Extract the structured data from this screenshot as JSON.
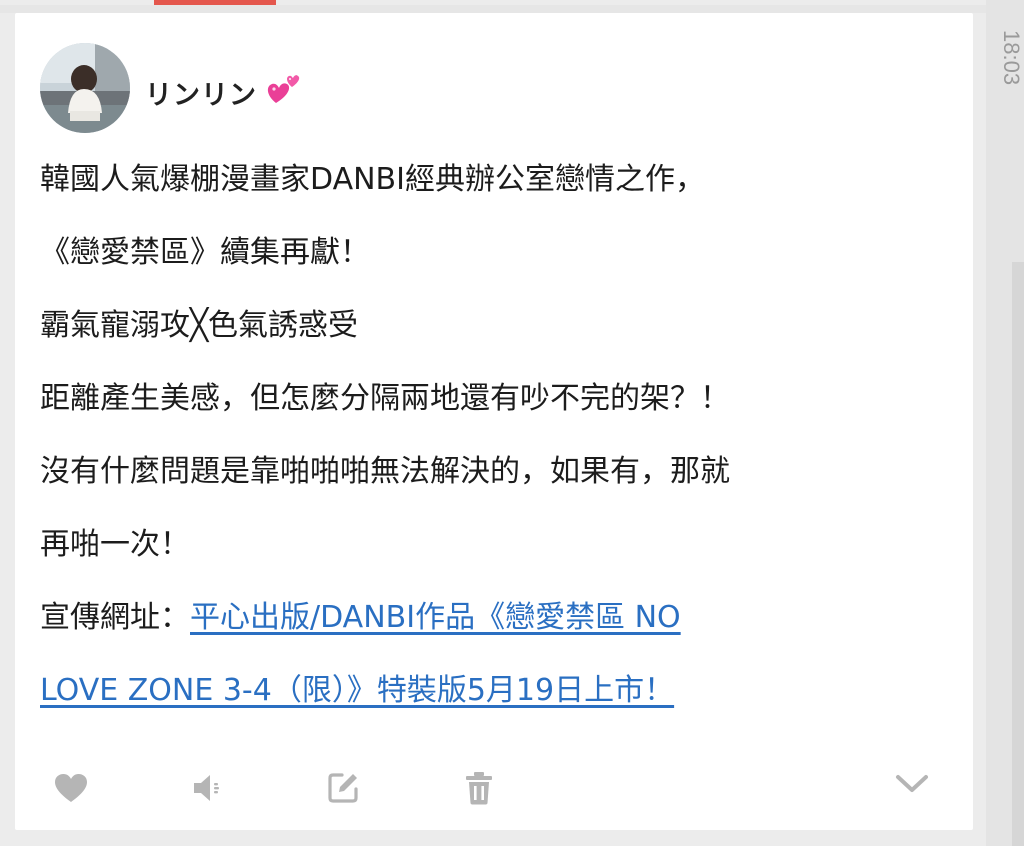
{
  "status_bar": {
    "time": "18:03"
  },
  "post": {
    "author_name": "リンリン",
    "author_emoji": "two-hearts-emoji",
    "lines": [
      "韓國人氣爆棚漫畫家DANBI經典辦公室戀情之作，",
      "《戀愛禁區》續集再獻！",
      "霸氣寵溺攻╳色氣誘惑受",
      "距離產生美感，但怎麼分隔兩地還有吵不完的架？！",
      "沒有什麼問題是靠啪啪啪無法解決的，如果有，那就",
      "再啪一次！"
    ],
    "promo_prefix": "宣傳網址：",
    "promo_link_line1": "平心出版/DANBI作品《戀愛禁區 NO",
    "promo_link_line2": "LOVE ZONE 3-4（限）》特裝版5月19日上市！"
  },
  "actions": {
    "like_icon": "heart-icon",
    "speak_icon": "speaker-icon",
    "edit_icon": "edit-icon",
    "delete_icon": "trash-icon",
    "expand_icon": "chevron-down-icon"
  },
  "colors": {
    "accent": "#e4574d",
    "link": "#2a6fc2",
    "icon": "#b5b5b5"
  }
}
